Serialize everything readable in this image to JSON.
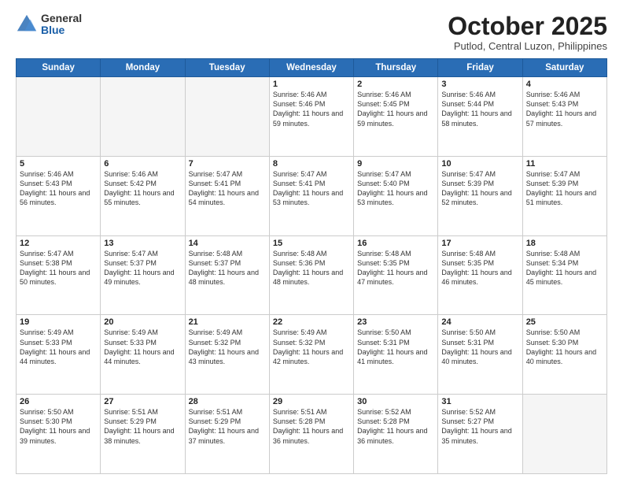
{
  "logo": {
    "general": "General",
    "blue": "Blue"
  },
  "header": {
    "month": "October 2025",
    "location": "Putlod, Central Luzon, Philippines"
  },
  "weekdays": [
    "Sunday",
    "Monday",
    "Tuesday",
    "Wednesday",
    "Thursday",
    "Friday",
    "Saturday"
  ],
  "weeks": [
    [
      {
        "day": "",
        "info": ""
      },
      {
        "day": "",
        "info": ""
      },
      {
        "day": "",
        "info": ""
      },
      {
        "day": "1",
        "info": "Sunrise: 5:46 AM\nSunset: 5:46 PM\nDaylight: 11 hours\nand 59 minutes."
      },
      {
        "day": "2",
        "info": "Sunrise: 5:46 AM\nSunset: 5:45 PM\nDaylight: 11 hours\nand 59 minutes."
      },
      {
        "day": "3",
        "info": "Sunrise: 5:46 AM\nSunset: 5:44 PM\nDaylight: 11 hours\nand 58 minutes."
      },
      {
        "day": "4",
        "info": "Sunrise: 5:46 AM\nSunset: 5:43 PM\nDaylight: 11 hours\nand 57 minutes."
      }
    ],
    [
      {
        "day": "5",
        "info": "Sunrise: 5:46 AM\nSunset: 5:43 PM\nDaylight: 11 hours\nand 56 minutes."
      },
      {
        "day": "6",
        "info": "Sunrise: 5:46 AM\nSunset: 5:42 PM\nDaylight: 11 hours\nand 55 minutes."
      },
      {
        "day": "7",
        "info": "Sunrise: 5:47 AM\nSunset: 5:41 PM\nDaylight: 11 hours\nand 54 minutes."
      },
      {
        "day": "8",
        "info": "Sunrise: 5:47 AM\nSunset: 5:41 PM\nDaylight: 11 hours\nand 53 minutes."
      },
      {
        "day": "9",
        "info": "Sunrise: 5:47 AM\nSunset: 5:40 PM\nDaylight: 11 hours\nand 53 minutes."
      },
      {
        "day": "10",
        "info": "Sunrise: 5:47 AM\nSunset: 5:39 PM\nDaylight: 11 hours\nand 52 minutes."
      },
      {
        "day": "11",
        "info": "Sunrise: 5:47 AM\nSunset: 5:39 PM\nDaylight: 11 hours\nand 51 minutes."
      }
    ],
    [
      {
        "day": "12",
        "info": "Sunrise: 5:47 AM\nSunset: 5:38 PM\nDaylight: 11 hours\nand 50 minutes."
      },
      {
        "day": "13",
        "info": "Sunrise: 5:47 AM\nSunset: 5:37 PM\nDaylight: 11 hours\nand 49 minutes."
      },
      {
        "day": "14",
        "info": "Sunrise: 5:48 AM\nSunset: 5:37 PM\nDaylight: 11 hours\nand 48 minutes."
      },
      {
        "day": "15",
        "info": "Sunrise: 5:48 AM\nSunset: 5:36 PM\nDaylight: 11 hours\nand 48 minutes."
      },
      {
        "day": "16",
        "info": "Sunrise: 5:48 AM\nSunset: 5:35 PM\nDaylight: 11 hours\nand 47 minutes."
      },
      {
        "day": "17",
        "info": "Sunrise: 5:48 AM\nSunset: 5:35 PM\nDaylight: 11 hours\nand 46 minutes."
      },
      {
        "day": "18",
        "info": "Sunrise: 5:48 AM\nSunset: 5:34 PM\nDaylight: 11 hours\nand 45 minutes."
      }
    ],
    [
      {
        "day": "19",
        "info": "Sunrise: 5:49 AM\nSunset: 5:33 PM\nDaylight: 11 hours\nand 44 minutes."
      },
      {
        "day": "20",
        "info": "Sunrise: 5:49 AM\nSunset: 5:33 PM\nDaylight: 11 hours\nand 44 minutes."
      },
      {
        "day": "21",
        "info": "Sunrise: 5:49 AM\nSunset: 5:32 PM\nDaylight: 11 hours\nand 43 minutes."
      },
      {
        "day": "22",
        "info": "Sunrise: 5:49 AM\nSunset: 5:32 PM\nDaylight: 11 hours\nand 42 minutes."
      },
      {
        "day": "23",
        "info": "Sunrise: 5:50 AM\nSunset: 5:31 PM\nDaylight: 11 hours\nand 41 minutes."
      },
      {
        "day": "24",
        "info": "Sunrise: 5:50 AM\nSunset: 5:31 PM\nDaylight: 11 hours\nand 40 minutes."
      },
      {
        "day": "25",
        "info": "Sunrise: 5:50 AM\nSunset: 5:30 PM\nDaylight: 11 hours\nand 40 minutes."
      }
    ],
    [
      {
        "day": "26",
        "info": "Sunrise: 5:50 AM\nSunset: 5:30 PM\nDaylight: 11 hours\nand 39 minutes."
      },
      {
        "day": "27",
        "info": "Sunrise: 5:51 AM\nSunset: 5:29 PM\nDaylight: 11 hours\nand 38 minutes."
      },
      {
        "day": "28",
        "info": "Sunrise: 5:51 AM\nSunset: 5:29 PM\nDaylight: 11 hours\nand 37 minutes."
      },
      {
        "day": "29",
        "info": "Sunrise: 5:51 AM\nSunset: 5:28 PM\nDaylight: 11 hours\nand 36 minutes."
      },
      {
        "day": "30",
        "info": "Sunrise: 5:52 AM\nSunset: 5:28 PM\nDaylight: 11 hours\nand 36 minutes."
      },
      {
        "day": "31",
        "info": "Sunrise: 5:52 AM\nSunset: 5:27 PM\nDaylight: 11 hours\nand 35 minutes."
      },
      {
        "day": "",
        "info": ""
      }
    ]
  ]
}
